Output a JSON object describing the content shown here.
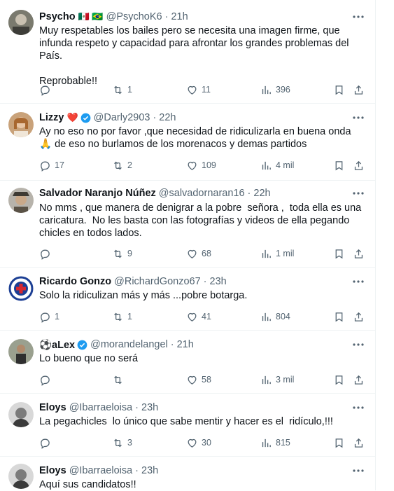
{
  "tweets": [
    {
      "name": "Psycho",
      "emoji": "🇲🇽 🇧🇷",
      "handle": "@PsychoK6",
      "time": "21h",
      "text": "Muy respetables los bailes pero se necesita una imagen firme, que infunda respeto y capacidad para afrontar los grandes problemas del País.\n\nReprobable!!",
      "replies": "",
      "retweets": "1",
      "likes": "11",
      "views": "396"
    },
    {
      "name": "Lizzy",
      "emoji": "❤️",
      "verified": true,
      "handle": "@Darly2903",
      "time": "22h",
      "text": "Ay no eso no por favor ,que necesidad de ridiculizarla en buena onda 🙏 de eso no burlamos de los morenacos y demas partidos",
      "replies": "17",
      "retweets": "2",
      "likes": "109",
      "views": "4 mil"
    },
    {
      "name": "Salvador Naranjo Núñez",
      "handle": "@salvadornaran16",
      "time": "22h",
      "text": "No mms , que manera de denigrar a la pobre  señora ,  toda ella es una caricatura.  No les basta con las fotografías y videos de ella pegando chicles en todos lados.",
      "replies": "",
      "retweets": "9",
      "likes": "68",
      "views": "1 mil"
    },
    {
      "name": "Ricardo Gonzo",
      "handle": "@RichardGonzo67",
      "time": "23h",
      "text": "Solo la ridiculizan más y más ...pobre botarga.",
      "replies": "1",
      "retweets": "1",
      "likes": "41",
      "views": "804"
    },
    {
      "name": "⚽aLex",
      "verified": true,
      "handle": "@morandelangel",
      "time": "21h",
      "text": "Lo bueno que no será",
      "replies": "",
      "retweets": "",
      "likes": "58",
      "views": "3 mil"
    },
    {
      "name": "Eloys",
      "handle": "@Ibarraeloisa",
      "time": "23h",
      "text": "La pegachicles  lo único que sabe mentir y hacer es el  ridículo,!!!",
      "replies": "",
      "retweets": "3",
      "likes": "30",
      "views": "815"
    },
    {
      "name": "Eloys",
      "handle": "@Ibarraeloisa",
      "time": "23h",
      "text": "Aquí sus candidatos!!",
      "replies": "",
      "retweets": "",
      "likes": "",
      "views": ""
    }
  ],
  "colors": {
    "muted": "#536471",
    "verified": "#1d9bf0",
    "heart": "#f91880"
  }
}
